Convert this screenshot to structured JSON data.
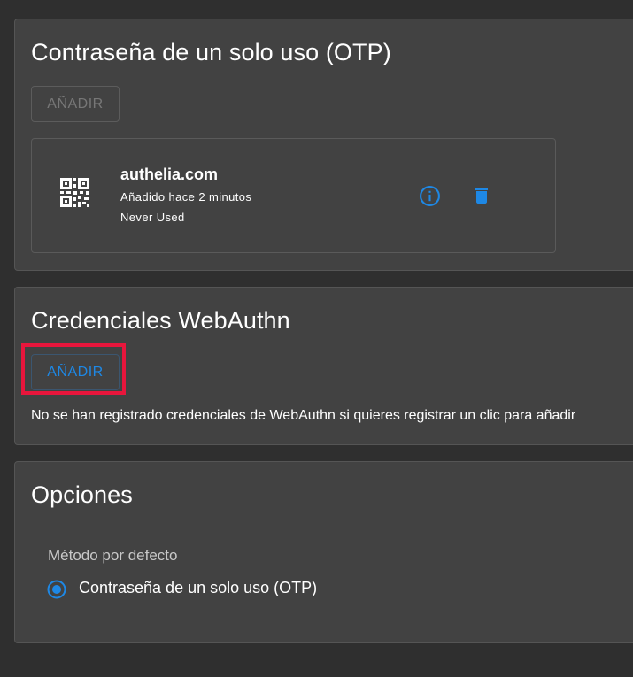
{
  "otp_section": {
    "title": "Contraseña de un solo uso (OTP)",
    "add_label": "AÑADIR",
    "device": {
      "icon": "qr-code-icon",
      "name": "authelia.com",
      "added": "Añadido hace 2 minutos",
      "usage": "Never Used"
    }
  },
  "webauthn_section": {
    "title": "Credenciales WebAuthn",
    "add_label": "AÑADIR",
    "empty_message": "No se han registrado credenciales de WebAuthn si quieres registrar un clic para añadir"
  },
  "options_section": {
    "title": "Opciones",
    "default_method_label": "Método por defecto",
    "methods": [
      {
        "label": "Contraseña de un solo uso (OTP)",
        "selected": true
      }
    ]
  },
  "colors": {
    "background": "#2f2f2f",
    "card": "#424242",
    "accent": "#1e88e5",
    "highlight": "#e8163c"
  }
}
